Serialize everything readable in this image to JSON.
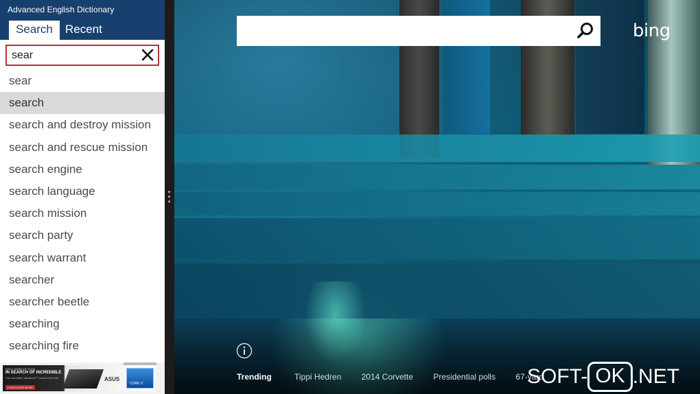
{
  "dictionary": {
    "app_title": "Advanced English Dictionary",
    "tabs": [
      {
        "label": "Search",
        "active": true
      },
      {
        "label": "Recent",
        "active": false
      }
    ],
    "search": {
      "value": "sear",
      "clear_icon": "close-x-icon"
    },
    "suggestions": [
      {
        "text": "sear",
        "selected": false
      },
      {
        "text": "search",
        "selected": true
      },
      {
        "text": "search and destroy mission",
        "selected": false
      },
      {
        "text": "search and rescue mission",
        "selected": false
      },
      {
        "text": "search engine",
        "selected": false
      },
      {
        "text": "search language",
        "selected": false
      },
      {
        "text": "search mission",
        "selected": false
      },
      {
        "text": "search party",
        "selected": false
      },
      {
        "text": "search warrant",
        "selected": false
      },
      {
        "text": "searcher",
        "selected": false
      },
      {
        "text": "searcher beetle",
        "selected": false
      },
      {
        "text": "searching",
        "selected": false
      },
      {
        "text": "searching fire",
        "selected": false
      }
    ],
    "ad": {
      "line1": "ASUS ZENBOOK Prime",
      "line2": "IN SEARCH OF INCREDIBLE",
      "line3": "The Incredible Ultrabook™ Inspired by Intel",
      "button": "▸ DISCOVER MORE",
      "brand": "ASUS",
      "badge": "CORE i7"
    }
  },
  "bing": {
    "logo": "bing",
    "search_value": "",
    "search_icon": "magnifier-icon",
    "info_icon": "info-icon",
    "trending_label": "Trending",
    "trending": [
      "Tippi Hedren",
      "2014 Corvette",
      "Presidential polls",
      "67-yard"
    ]
  },
  "watermark": {
    "left": "SOFT-",
    "boxed": "OK",
    "right": ".NET"
  },
  "colors": {
    "header_bg": "#18406f",
    "search_border": "#b3303c",
    "selected_row": "#d9d9d9",
    "splitter": "#1c1c1c"
  }
}
